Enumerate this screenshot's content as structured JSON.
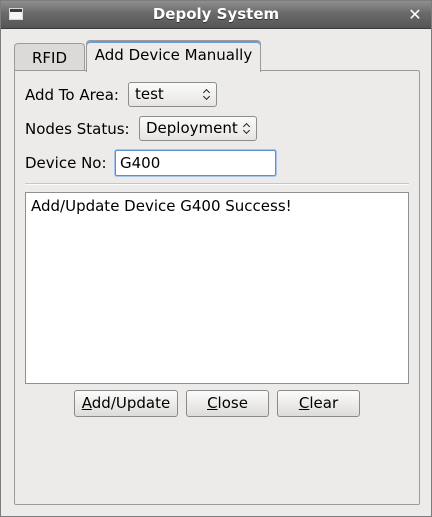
{
  "window": {
    "title": "Depoly System"
  },
  "tabs": [
    {
      "label": "RFID",
      "selected": false
    },
    {
      "label": "Add Device Manually",
      "selected": true
    }
  ],
  "form": {
    "area": {
      "label": "Add To Area:",
      "value": "test"
    },
    "status": {
      "label": "Nodes Status:",
      "value": "Deployment"
    },
    "device": {
      "label": "Device No:",
      "value": "G400"
    }
  },
  "log": {
    "text": "Add/Update Device G400 Success!"
  },
  "buttons": {
    "add_update": {
      "mnemonic": "A",
      "rest": "dd/Update"
    },
    "close": {
      "mnemonic": "C",
      "rest": "lose"
    },
    "clear": {
      "mnemonic": "C",
      "rest": "lear"
    }
  },
  "colors": {
    "title_bar": "#6a6a6a",
    "focus_border": "#5b8fd0",
    "window_bg": "#edebea"
  }
}
